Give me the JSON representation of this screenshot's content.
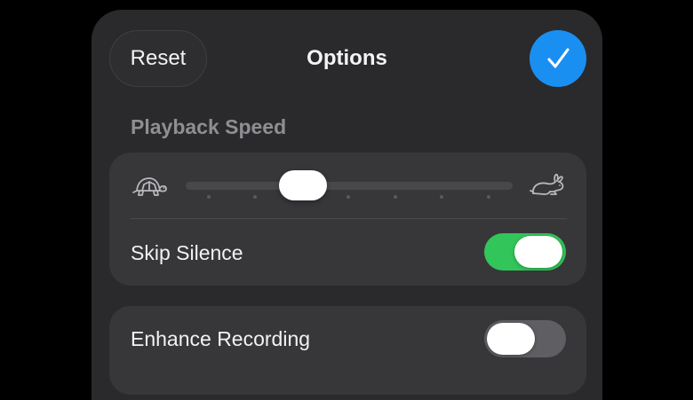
{
  "header": {
    "reset_label": "Reset",
    "title": "Options",
    "done_icon": "checkmark-icon"
  },
  "playback_speed": {
    "section_label": "Playback Speed",
    "slow_icon": "turtle-icon",
    "fast_icon": "rabbit-icon",
    "slider_value_fraction": 0.36,
    "tick_count": 7
  },
  "skip_silence": {
    "label": "Skip Silence",
    "enabled": true
  },
  "enhance_recording": {
    "label": "Enhance Recording",
    "enabled": false
  },
  "colors": {
    "accent_blue": "#1a8ff2",
    "toggle_on": "#32c55a",
    "toggle_off": "#5f5f63",
    "sheet_background": "#2a2a2c",
    "group_background": "#37373a"
  }
}
